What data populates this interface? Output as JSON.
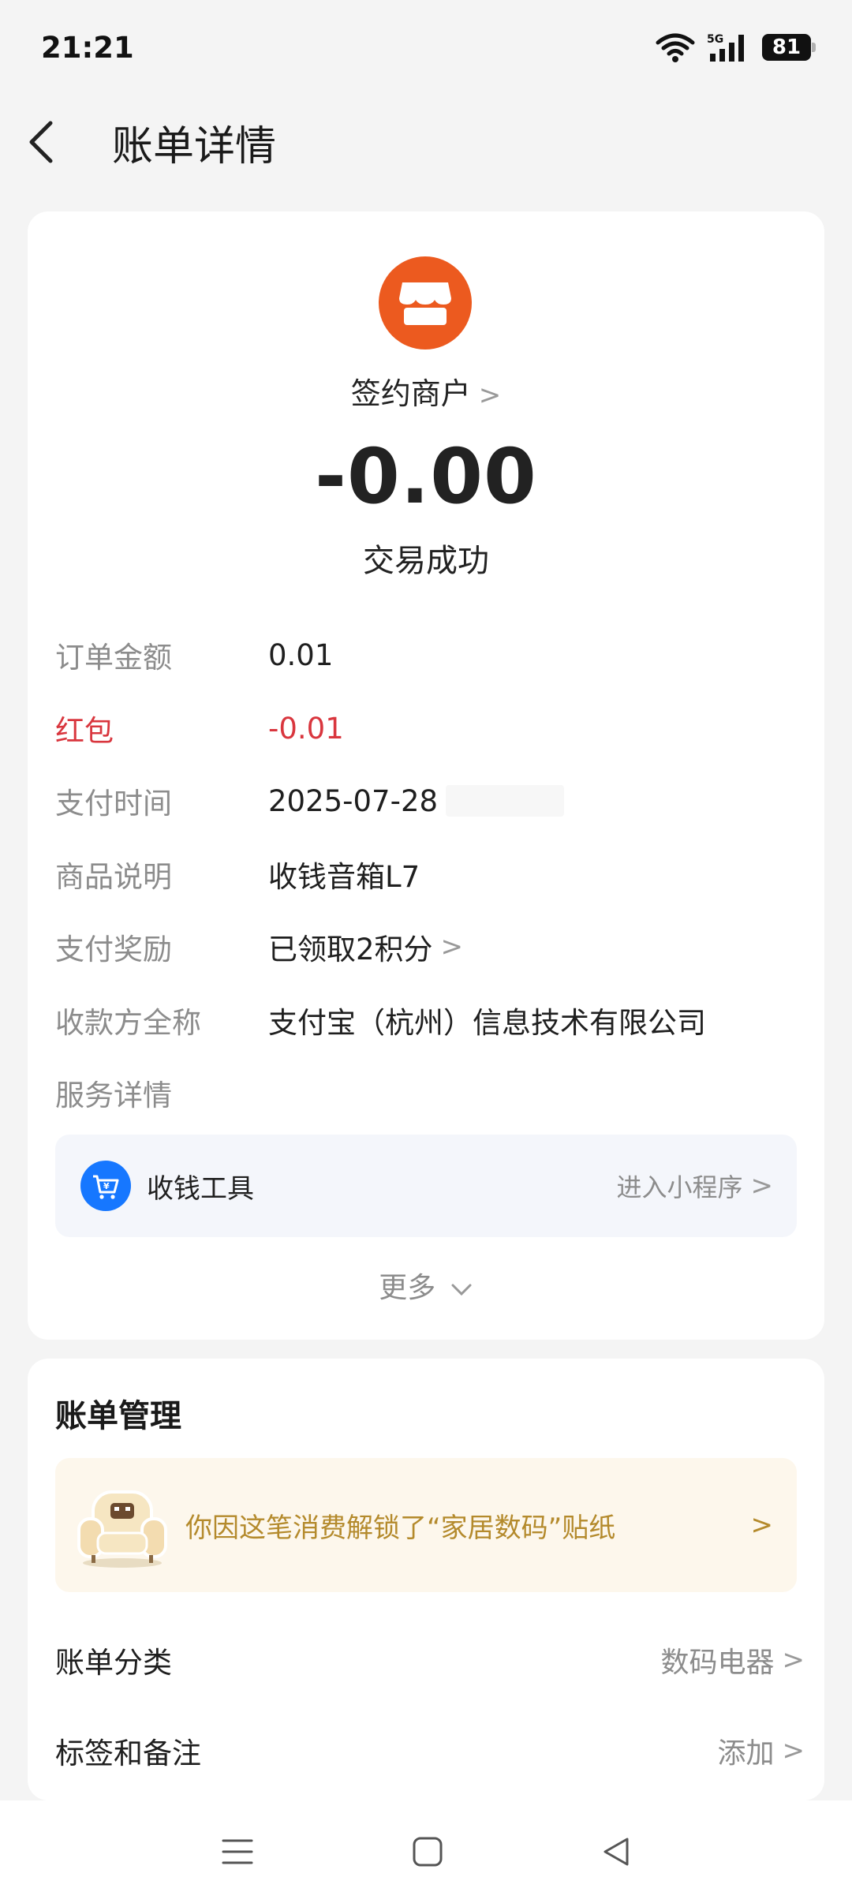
{
  "status_bar": {
    "time": "21:21",
    "network": "5G",
    "battery": "81"
  },
  "header": {
    "title": "账单详情"
  },
  "merchant": {
    "name": "签约商户",
    "amount": "-0.00",
    "status": "交易成功"
  },
  "details": [
    {
      "label": "订单金额",
      "value": "0.01"
    },
    {
      "label": "红包",
      "value": "-0.01"
    },
    {
      "label": "支付时间",
      "value": "2025-07-28"
    },
    {
      "label": "商品说明",
      "value": "收钱音箱L7"
    },
    {
      "label": "支付奖励",
      "value": "已领取2积分"
    },
    {
      "label": "收款方全称",
      "value": "支付宝（杭州）信息技术有限公司"
    },
    {
      "label": "服务详情",
      "value": ""
    }
  ],
  "service": {
    "label": "收钱工具",
    "link": "进入小程序"
  },
  "more_label": "更多",
  "manage": {
    "title": "账单管理",
    "sticker_text": "你因这笔消费解锁了“家居数码”贴纸",
    "rows": [
      {
        "label": "账单分类",
        "value": "数码电器"
      },
      {
        "label": "标签和备注",
        "value": "添加"
      }
    ]
  },
  "colors": {
    "merchant_icon": "#ec5a1f",
    "red_packet": "#d9363e",
    "tool_icon": "#1677ff",
    "sticker_text": "#b48a2c"
  }
}
